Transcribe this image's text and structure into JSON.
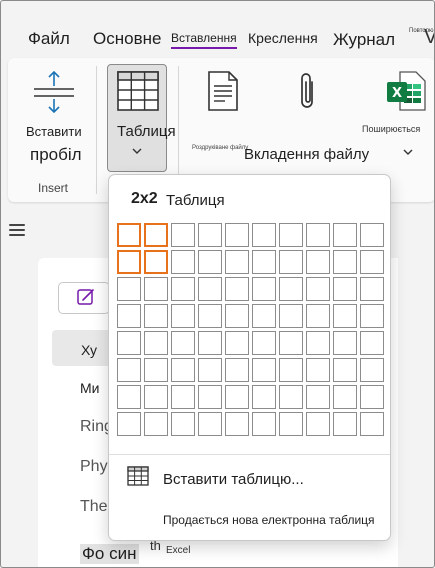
{
  "tabs": [
    {
      "label": "Файл"
    },
    {
      "label": "Основне"
    },
    {
      "label": "Вставлення"
    },
    {
      "label": "Креслення"
    },
    {
      "label": "Журнал"
    },
    {
      "label": "Повторю"
    },
    {
      "label": "V"
    }
  ],
  "ribbon": {
    "space": {
      "line1": "Вставити",
      "line2": "пробіл"
    },
    "group_label": "Insert",
    "table_label": "Таблиця",
    "attach_small": "Роздруківане файлу",
    "attach_label": "Вкладення файлу",
    "spread_small": "Поширюється",
    "icons": {
      "space": "insert-space-icon",
      "table": "table-grid-icon",
      "printout": "file-printout-icon",
      "attach": "paperclip-icon",
      "excel": "excel-icon"
    }
  },
  "dropdown": {
    "size_text": "2x2",
    "size_label": "Таблиця",
    "grid": {
      "rows": 8,
      "cols": 10,
      "selected_rows": 2,
      "selected_cols": 2
    },
    "insert_table": "Вставити таблицю...",
    "new_spreadsheet": "Продається нова електронна таблиця",
    "colors": {
      "selected": "#e8711c",
      "excel": "#107c41"
    }
  },
  "page": {
    "lines": [
      "Ху",
      "Ми",
      "Ring",
      "Phy",
      "The",
      "Фо син"
    ],
    "excel_sub": "Excel",
    "excel_super": "th"
  },
  "colors": {
    "accent": "#7719aa"
  }
}
